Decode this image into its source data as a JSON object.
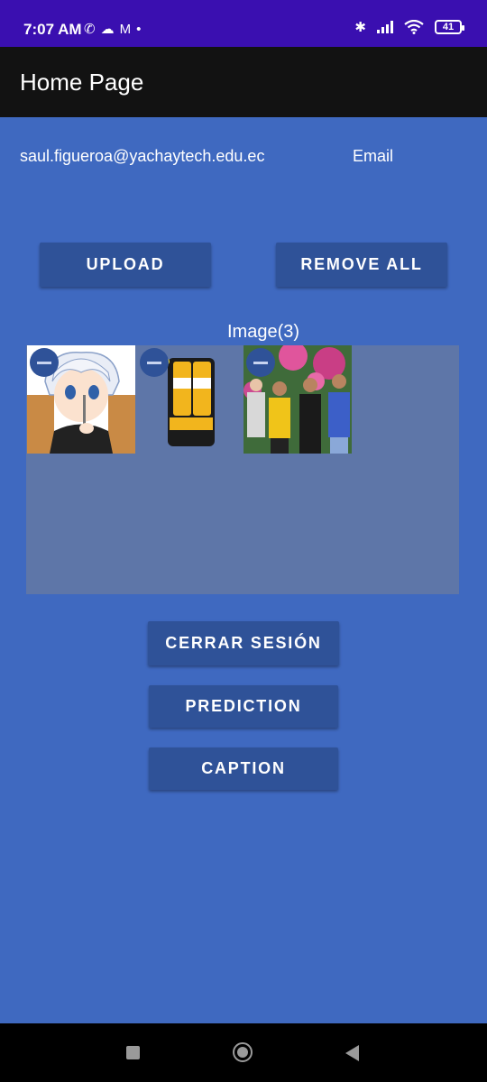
{
  "status_bar": {
    "time": "7:07 AM",
    "left_icons": [
      "whatsapp-icon",
      "cloud-icon",
      "gmail-icon",
      "dot-icon"
    ],
    "right_icons": [
      "bluetooth-icon",
      "signal-icon",
      "wifi-icon"
    ],
    "battery": "41"
  },
  "app_bar": {
    "title": "Home Page"
  },
  "user": {
    "email": "saul.figueroa@yachaytech.edu.ec",
    "email_label": "Email"
  },
  "buttons": {
    "upload": "UPLOAD",
    "remove_all": "REMOVE ALL",
    "cerrar_sesion": "CERRAR SESIÓN",
    "prediction": "PREDICTION",
    "caption": "CAPTION"
  },
  "images": {
    "title": "Image(3)",
    "thumbnails": [
      "anime-character-thumbnail",
      "beverage-bottles-thumbnail",
      "group-photo-thumbnail"
    ]
  },
  "nav": [
    "recents-icon",
    "home-icon",
    "back-icon"
  ]
}
